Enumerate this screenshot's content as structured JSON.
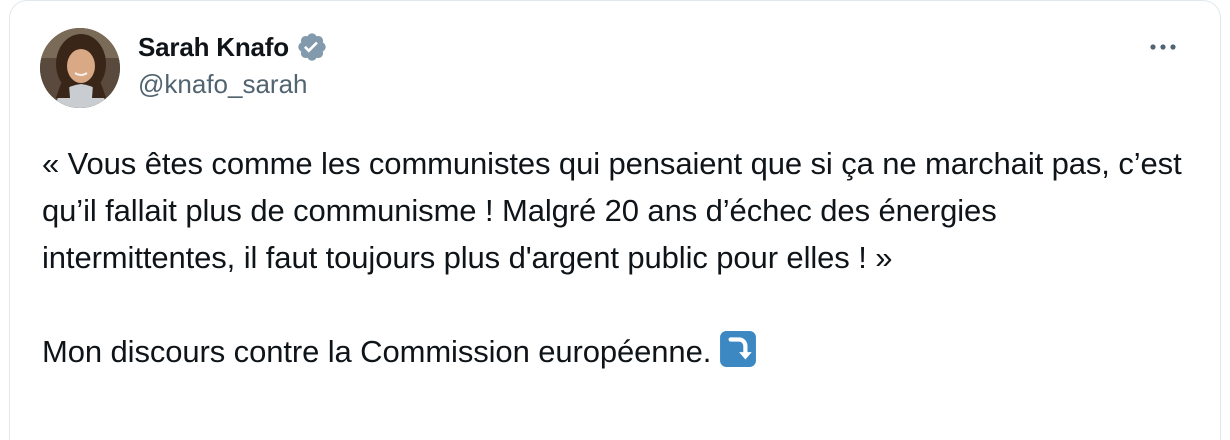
{
  "author": {
    "display_name": "Sarah Knafo",
    "handle": "@knafo_sarah",
    "verified": true,
    "avatar_icon": "profile-photo"
  },
  "tweet": {
    "quote_text": "« Vous êtes comme les communistes qui pensaient que si ça ne marchait pas, c’est qu’il fallait plus de communisme ! Malgré 20 ans d’échec des énergies intermittentes, il faut toujours plus d'argent public pour elles ! »",
    "follow_text": "Mon discours contre la Commission européenne.",
    "emoji_icon": "arrow-curving-down-icon"
  },
  "colors": {
    "text": "#0f1419",
    "secondary_text": "#536471",
    "verified_badge": "#829aab",
    "emoji_blue": "#3b88c3",
    "border": "#e1e8ed"
  },
  "icons": {
    "more": "more-horizontal-icon",
    "verified": "verified-badge-icon"
  }
}
